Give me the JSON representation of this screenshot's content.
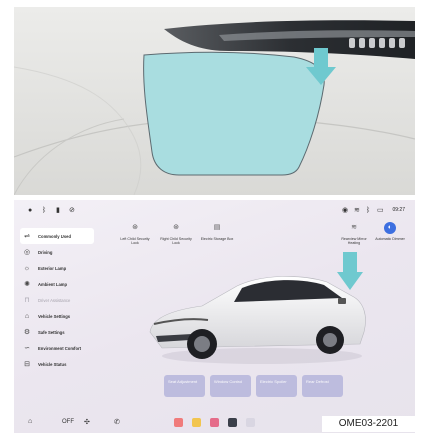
{
  "photo": {
    "highlight_color": "#a9dde0",
    "arrow_color": "#6fc9cf"
  },
  "screen": {
    "status": {
      "left_icons": [
        "circle-icon",
        "bluetooth-icon",
        "mic-icon",
        "wifi-off-icon"
      ],
      "right_icons": [
        "location-icon",
        "wifi-icon",
        "bluetooth-icon",
        "battery-icon"
      ],
      "time": "09:27"
    },
    "menu": [
      {
        "label": "Commonly Used",
        "icon": "car-icon",
        "state": "active"
      },
      {
        "label": "Driving",
        "icon": "steering-icon",
        "state": "normal"
      },
      {
        "label": "Exterior Lamp",
        "icon": "lamp-icon",
        "state": "normal"
      },
      {
        "label": "Ambient Lamp",
        "icon": "ambient-icon",
        "state": "normal"
      },
      {
        "label": "Driver Assistance",
        "icon": "assist-icon",
        "state": "dim"
      },
      {
        "label": "Vehicle Settings",
        "icon": "vehicle-icon",
        "state": "normal"
      },
      {
        "label": "Safe Settings",
        "icon": "safe-icon",
        "state": "normal"
      },
      {
        "label": "Environment Comfort",
        "icon": "comfort-icon",
        "state": "normal"
      },
      {
        "label": "Vehicle Status",
        "icon": "status-icon",
        "state": "normal"
      }
    ],
    "quick_actions": [
      {
        "label": "Left Child Security Lock",
        "icon": "child-lock-icon"
      },
      {
        "label": "Right Child Security Lock",
        "icon": "child-lock-icon"
      },
      {
        "label": "Electric Storage Box",
        "icon": "storage-icon"
      },
      {
        "label": "Rearview Mirror Heating",
        "icon": "mirror-heat-icon"
      },
      {
        "label": "Automatic Dimmer",
        "icon": "auto-dim-icon"
      }
    ],
    "tiles": [
      {
        "label": "Seat Adjustment"
      },
      {
        "label": "Window Control"
      },
      {
        "label": "Electric Spoiler"
      },
      {
        "label": "Rear Defrost"
      }
    ],
    "dock": {
      "ac_label": "OFF"
    },
    "accent": "#3d6fe0",
    "arrow_color": "#6fc9cf"
  },
  "caption": "OME03-2201"
}
